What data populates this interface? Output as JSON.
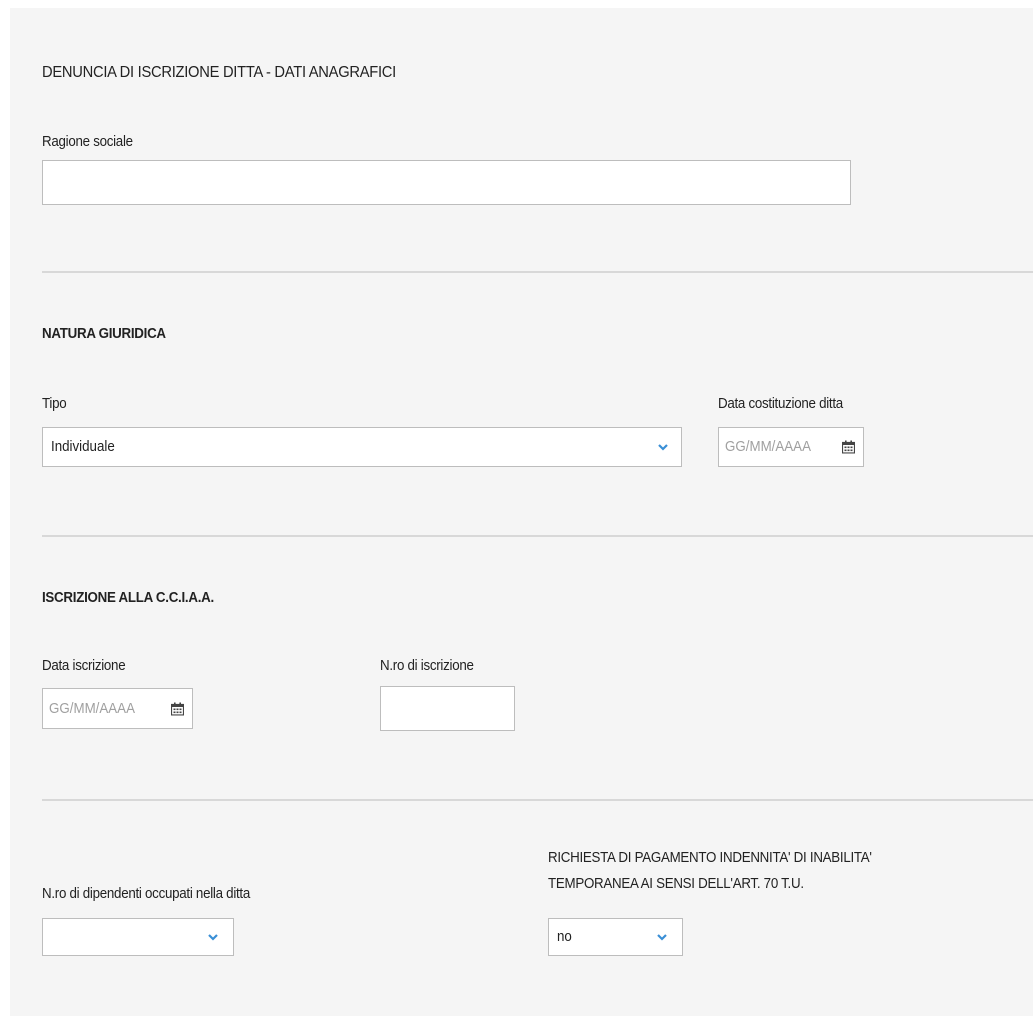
{
  "header": {
    "title": "DENUNCIA DI ISCRIZIONE DITTA - DATI ANAGRAFICI"
  },
  "ragione_sociale": {
    "label": "Ragione sociale",
    "value": "",
    "placeholder": ""
  },
  "natura_giuridica": {
    "title": "NATURA GIURIDICA",
    "tipo": {
      "label": "Tipo",
      "selected": "Individuale",
      "icon": "chevron-down-icon"
    },
    "data_costituzione": {
      "label": "Data costituzione ditta",
      "placeholder": "GG/MM/AAAA",
      "icon": "calendar-icon"
    }
  },
  "iscrizione_cciaa": {
    "title": "ISCRIZIONE ALLA C.C.I.A.A.",
    "data_iscrizione": {
      "label": "Data iscrizione",
      "placeholder": "GG/MM/AAAA",
      "icon": "calendar-icon"
    },
    "numero_iscrizione": {
      "label": "N.ro di iscrizione",
      "value": ""
    }
  },
  "dipendenti": {
    "label": "N.ro di dipendenti occupati nella ditta",
    "selected": "",
    "icon": "chevron-down-icon"
  },
  "richiesta_pagamento": {
    "label_line1": "RICHIESTA DI PAGAMENTO INDENNITA' DI INABILITA'",
    "label_line2": "TEMPORANEA AI SENSI DELL'ART. 70 T.U.",
    "selected": "no",
    "icon": "chevron-down-icon"
  },
  "colors": {
    "accent": "#3a8fd6",
    "panel": "#f5f5f5",
    "border": "#bdbdbd",
    "rule": "#d8d8d8"
  }
}
